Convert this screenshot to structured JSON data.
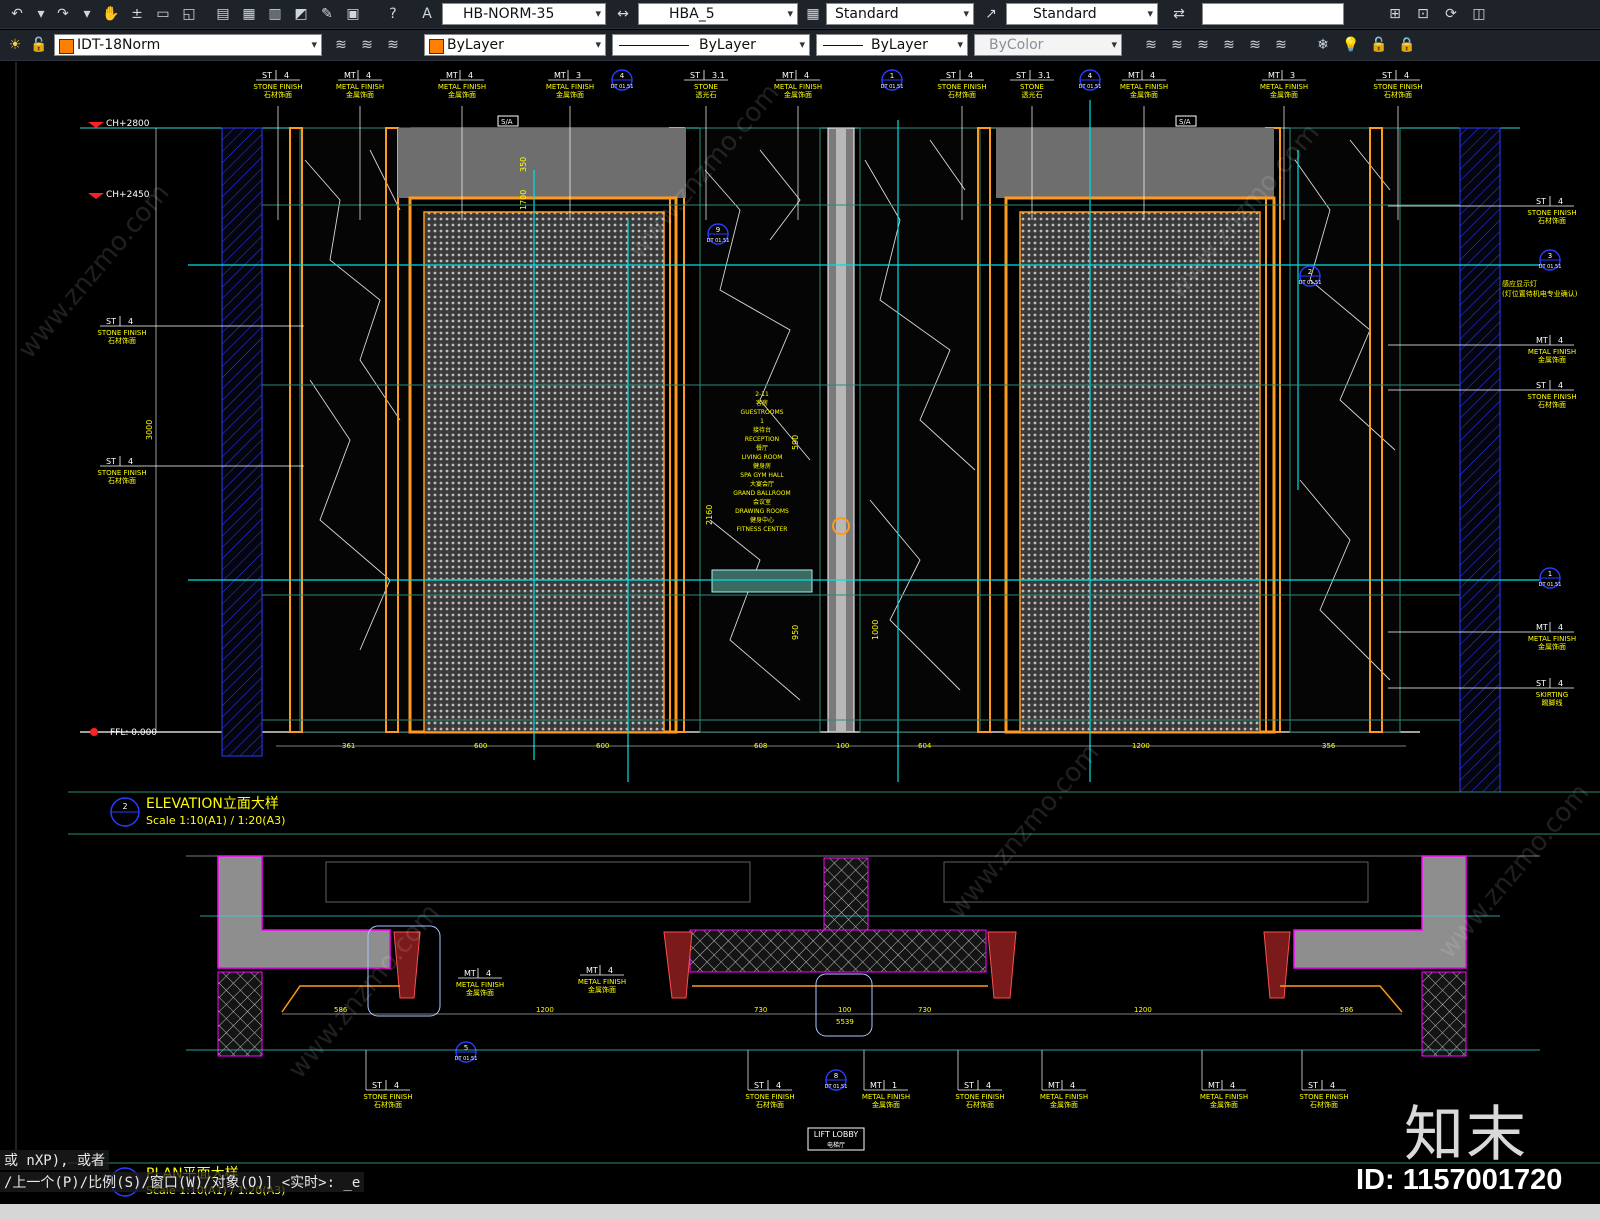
{
  "toolbar1": {
    "icons": [
      "undo-icon",
      "redo-icon",
      "pan-icon",
      "zoom-realtime-icon",
      "zoom-window-icon",
      "zoom-previous-icon",
      "properties-icon",
      "design-center-icon",
      "tool-palettes-icon",
      "sheet-set-icon",
      "markup-icon",
      "quickcalc-icon",
      "help-icon",
      "text-style-icon",
      "dim-style-icon",
      "table-style-icon",
      "multileader-style-icon",
      "layer-state-icon"
    ],
    "text_style": "HB-NORM-35",
    "dim_style": "HBA_5",
    "table_style": "Standard",
    "mleader_style": "Standard",
    "search_value": ""
  },
  "toolbar2": {
    "layer": "IDT-18Norm",
    "color": "ByLayer",
    "linetype": "ByLayer",
    "lineweight": "ByLayer",
    "plotstyle": "ByColor"
  },
  "colors": {
    "background": "#000000",
    "layer_swatch": "#ff7f00",
    "frame_orange": "#ff9a1a",
    "annotation_yellow": "#ffff00",
    "centerline_cyan": "#00e0e0",
    "wall_blue": "#2a3cff"
  },
  "drawing": {
    "levels": [
      "CH+2800",
      "CH+2450",
      "FFL: 0.000"
    ],
    "elevation_title": "ELEVATION立面大样",
    "elevation_scale": "Scale 1:10(A1) / 1:20(A3)",
    "elevation_number": "2",
    "plan_title": "PLAN平面大样",
    "plan_scale": "Scale 1:10(A1) / 1:20(A3)",
    "lift_lobby": "LIFT LOBBY",
    "lift_lobby_cn": "电梯厅",
    "top_tags": [
      {
        "code": "ST",
        "num": "4",
        "t1": "STONE FINISH",
        "t2": "石材饰面"
      },
      {
        "code": "MT",
        "num": "4",
        "t1": "METAL FINISH",
        "t2": "金属饰面"
      },
      {
        "code": "MT",
        "num": "4",
        "t1": "METAL FINISH",
        "t2": "金属饰面"
      },
      {
        "code": "MT",
        "num": "3",
        "t1": "METAL FINISH",
        "t2": "金属饰面"
      },
      {
        "code": "ST",
        "num": "3.1",
        "t1": "STONE",
        "t2": "透光石"
      },
      {
        "code": "MT",
        "num": "4",
        "t1": "METAL FINISH",
        "t2": "金属饰面"
      },
      {
        "code": "ST",
        "num": "4",
        "t1": "STONE FINISH",
        "t2": "石材饰面"
      },
      {
        "code": "ST",
        "num": "3.1",
        "t1": "STONE",
        "t2": "透光石"
      },
      {
        "code": "MT",
        "num": "4",
        "t1": "METAL FINISH",
        "t2": "金属饰面"
      },
      {
        "code": "MT",
        "num": "3",
        "t1": "METAL FINISH",
        "t2": "金属饰面"
      },
      {
        "code": "ST",
        "num": "4",
        "t1": "STONE FINISH",
        "t2": "石材饰面"
      }
    ],
    "left_tags": [
      {
        "code": "ST",
        "num": "4",
        "t1": "STONE FINISH",
        "t2": "石材饰面"
      },
      {
        "code": "ST",
        "num": "4",
        "t1": "STONE FINISH",
        "t2": "石材饰面"
      }
    ],
    "right_tags": [
      {
        "code": "ST",
        "num": "4",
        "t1": "STONE FINISH",
        "t2": "石材饰面"
      },
      {
        "code": "MT",
        "num": "4",
        "t1": "METAL FINISH",
        "t2": "金属饰面"
      },
      {
        "code": "ST",
        "num": "4",
        "t1": "STONE FINISH",
        "t2": "石材饰面"
      },
      {
        "code": "MT",
        "num": "4",
        "t1": "METAL FINISH",
        "t2": "金属饰面"
      },
      {
        "code": "ST",
        "num": "4",
        "t1": "SKIRTING",
        "t2": "踢脚线"
      }
    ],
    "bottom_tags": [
      {
        "code": "ST",
        "num": "4",
        "t1": "STONE FINISH",
        "t2": "石材饰面"
      },
      {
        "code": "ST",
        "num": "4",
        "t1": "STONE FINISH",
        "t2": "石材饰面"
      },
      {
        "code": "MT",
        "num": "1",
        "t1": "METAL FINISH",
        "t2": "金属饰面"
      },
      {
        "code": "ST",
        "num": "4",
        "t1": "STONE FINISH",
        "t2": "石材饰面"
      },
      {
        "code": "MT",
        "num": "4",
        "t1": "METAL FINISH",
        "t2": "金属饰面"
      },
      {
        "code": "MT",
        "num": "4",
        "t1": "METAL FINISH",
        "t2": "金属饰面"
      },
      {
        "code": "ST",
        "num": "4",
        "t1": "STONE FINISH",
        "t2": "石材饰面"
      }
    ],
    "plan_side_tags": [
      {
        "code": "MT",
        "num": "4",
        "t1": "METAL FINISH",
        "t2": "金属饰面"
      },
      {
        "code": "MT",
        "num": "4",
        "t1": "METAL FINISH",
        "t2": "金属饰面"
      }
    ],
    "dims_elevation": [
      "600",
      "600",
      "608",
      "100",
      "604",
      "1200",
      "361",
      "356"
    ],
    "dims_plan": [
      "586",
      "1200",
      "730",
      "100",
      "730",
      "1200",
      "586",
      "5539"
    ],
    "vertical_dims": [
      "3000",
      "350",
      "1700",
      "2160",
      "590",
      "950",
      "1000"
    ],
    "callout_bubbles": [
      "4",
      "1",
      "4",
      "9",
      "3",
      "2",
      "1",
      "5",
      "8"
    ],
    "detail_ref": "DT 01.51",
    "directory_lines": [
      "2-11",
      "客房",
      "GUESTROOMS",
      "1",
      "接待台",
      "RECEPTION",
      "餐厅",
      "LIVING ROOM",
      "健身房",
      "SPA GYM HALL",
      "大宴会厅",
      "GRAND BALLROOM",
      "会议室",
      "DRAWING ROOMS",
      "健身中心",
      "FITNESS CENTER"
    ],
    "right_note_cn": "感应显示灯",
    "right_note_sub": "(灯位置待机电专业确认)",
    "sa_label": "S/A",
    "watermark_site": "www.znzmo.com"
  },
  "command": {
    "line1": "或 nXP), 或者",
    "line2": "/上一个(P)/比例(S)/窗口(W)/对象(O)] <实时>: _e"
  },
  "watermark": "知末",
  "image_id": "ID: 1157001720"
}
